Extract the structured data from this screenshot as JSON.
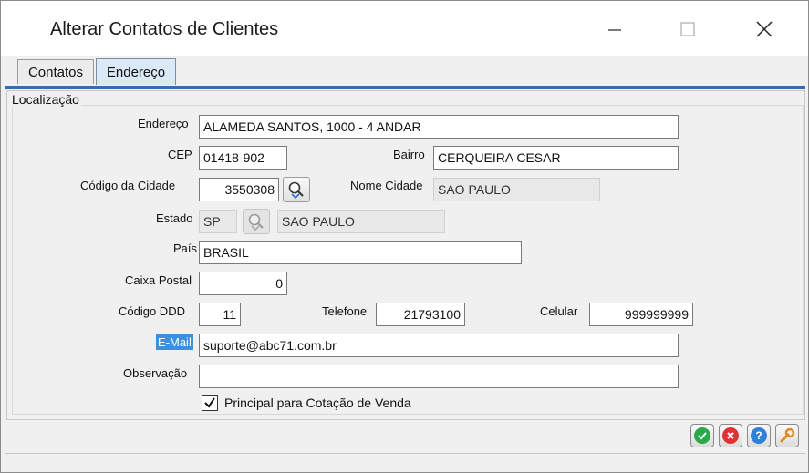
{
  "window": {
    "title": "Alterar Contatos de Clientes"
  },
  "tabs": [
    {
      "label": "Contatos"
    },
    {
      "label": "Endereço",
      "active": true
    }
  ],
  "group": {
    "label": "Localização"
  },
  "fields": {
    "endereco": {
      "label": "Endereço",
      "value": "ALAMEDA SANTOS, 1000 - 4 ANDAR"
    },
    "cep": {
      "label": "CEP",
      "value": "01418-902"
    },
    "bairro": {
      "label": "Bairro",
      "value": "CERQUEIRA CESAR"
    },
    "codigo_cidade": {
      "label": "Código da Cidade",
      "value": "3550308"
    },
    "nome_cidade": {
      "label": "Nome Cidade",
      "value": "SAO PAULO"
    },
    "estado": {
      "label": "Estado",
      "value": "SP",
      "nome": "SAO PAULO"
    },
    "pais": {
      "label": "País",
      "value": "BRASIL"
    },
    "caixa_postal": {
      "label": "Caixa Postal",
      "value": "0"
    },
    "codigo_ddd": {
      "label": "Código DDD",
      "value": "11"
    },
    "telefone": {
      "label": "Telefone",
      "value": "21793100"
    },
    "celular": {
      "label": "Celular",
      "value": "999999999"
    },
    "email": {
      "label": "E-Mail",
      "value": "suporte@abc71.com.br"
    },
    "observacao": {
      "label": "Observação",
      "value": ""
    }
  },
  "checkbox": {
    "label": "Principal para Cotação de Venda",
    "checked": true
  },
  "actions": {
    "ok_color": "#2aa84a",
    "cancel_color": "#e03232",
    "help_color": "#2f7fd8",
    "tools_color": "#e08a1e"
  }
}
